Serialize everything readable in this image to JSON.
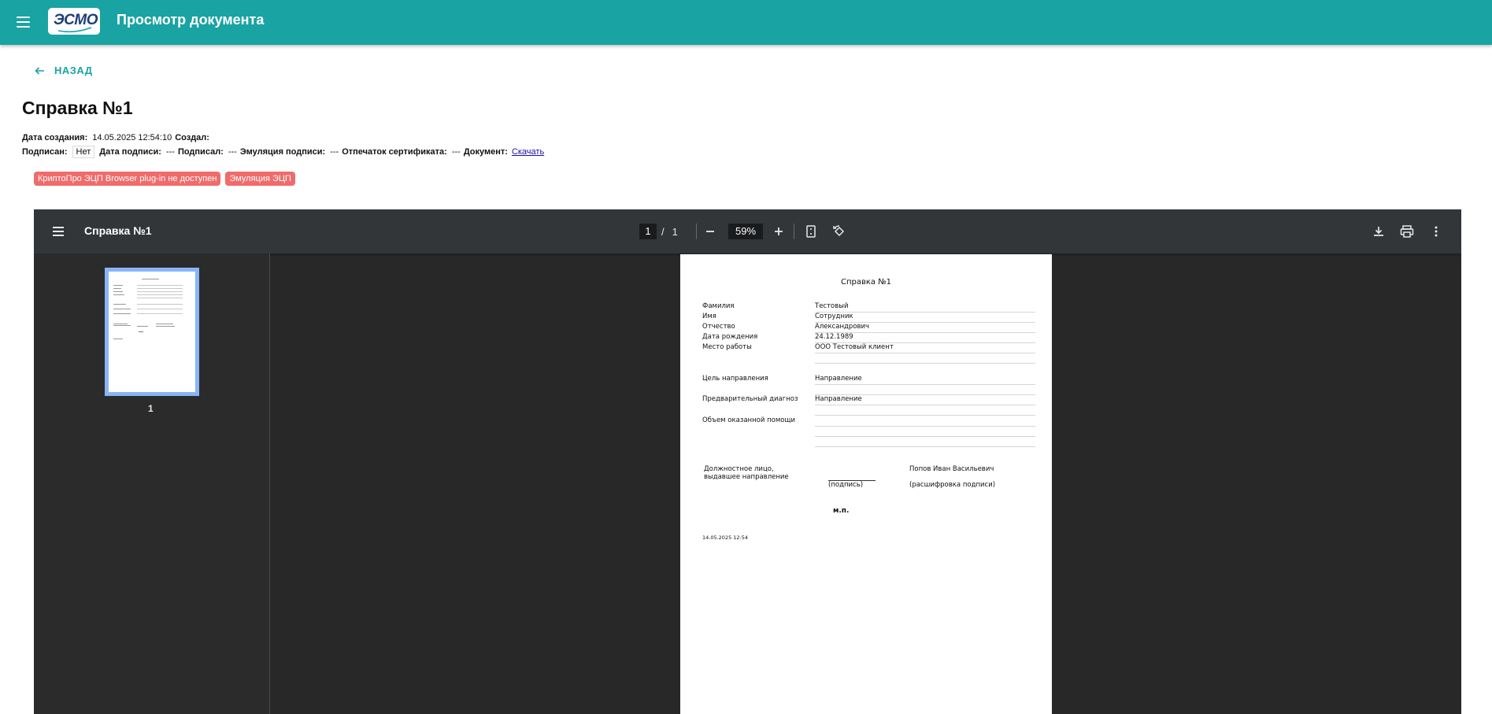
{
  "app": {
    "title": "Просмотр документа",
    "logo_text": "ЭСМО"
  },
  "nav": {
    "back_label": "НАЗАД"
  },
  "document": {
    "title": "Справка №1",
    "created_label": "Дата создания:",
    "created_value": "14.05.2025 12:54:10",
    "creator_label": "Создал:",
    "signed_label": "Подписан:",
    "signed_value": "Нет",
    "sign_date_label": "Дата подписи:",
    "sign_date_value": "---",
    "signer_label": "Подписал:",
    "signer_value": "---",
    "emulation_label": "Эмуляция подписи:",
    "emulation_value": "---",
    "cert_label": "Отпечаток сертификата:",
    "cert_value": "---",
    "doc_label": "Документ:",
    "download_link": "Скачать"
  },
  "badges": [
    {
      "text": "КриптоПро ЭЦП Browser plug-in не доступен",
      "color": "#f06b6b"
    },
    {
      "text": "Эмуляция ЭЦП",
      "color": "#f06b6b"
    }
  ],
  "viewer": {
    "title": "Справка №1",
    "page_current": "1",
    "page_separator": "/",
    "page_total": "1",
    "zoom": "59%",
    "thumb_label": "1",
    "icons": [
      "menu-icon",
      "zoom-out-icon",
      "zoom-in-icon",
      "fit-page-icon",
      "rotate-icon",
      "download-icon",
      "print-icon",
      "more-vert-icon"
    ]
  },
  "pdf_page": {
    "title": "Справка №1",
    "rows": [
      {
        "label": "Фамилия",
        "value": "Тестовый"
      },
      {
        "label": "Имя",
        "value": "Сотрудник"
      },
      {
        "label": "Отчество",
        "value": "Александрович"
      },
      {
        "label": "Дата рождения",
        "value": "24.12.1989"
      },
      {
        "label": "Место работы",
        "value": "ООО Тестовый клиент"
      },
      {
        "label": "Цель направления",
        "value": "Направление"
      },
      {
        "label": "Предварительный диагноз",
        "value": "Направление"
      },
      {
        "label": "Объем оказанной помощи",
        "value": ""
      }
    ],
    "official_line1": "Должностное лицо,",
    "official_line2": "выдавшее направление",
    "signature_caption": "(подпись)",
    "signer_name": "Попов Иван Васильевич",
    "signer_caption": "(расшифровка подписи)",
    "stamp_mark": "м.п.",
    "timestamp": "14.05.2025 12:54"
  },
  "colors": {
    "accent": "#1aa3a3",
    "badge": "#f06b6b",
    "viewer_bg": "#282828",
    "toolbar_bg": "#323639",
    "thumb_border": "#8ab4f8"
  }
}
